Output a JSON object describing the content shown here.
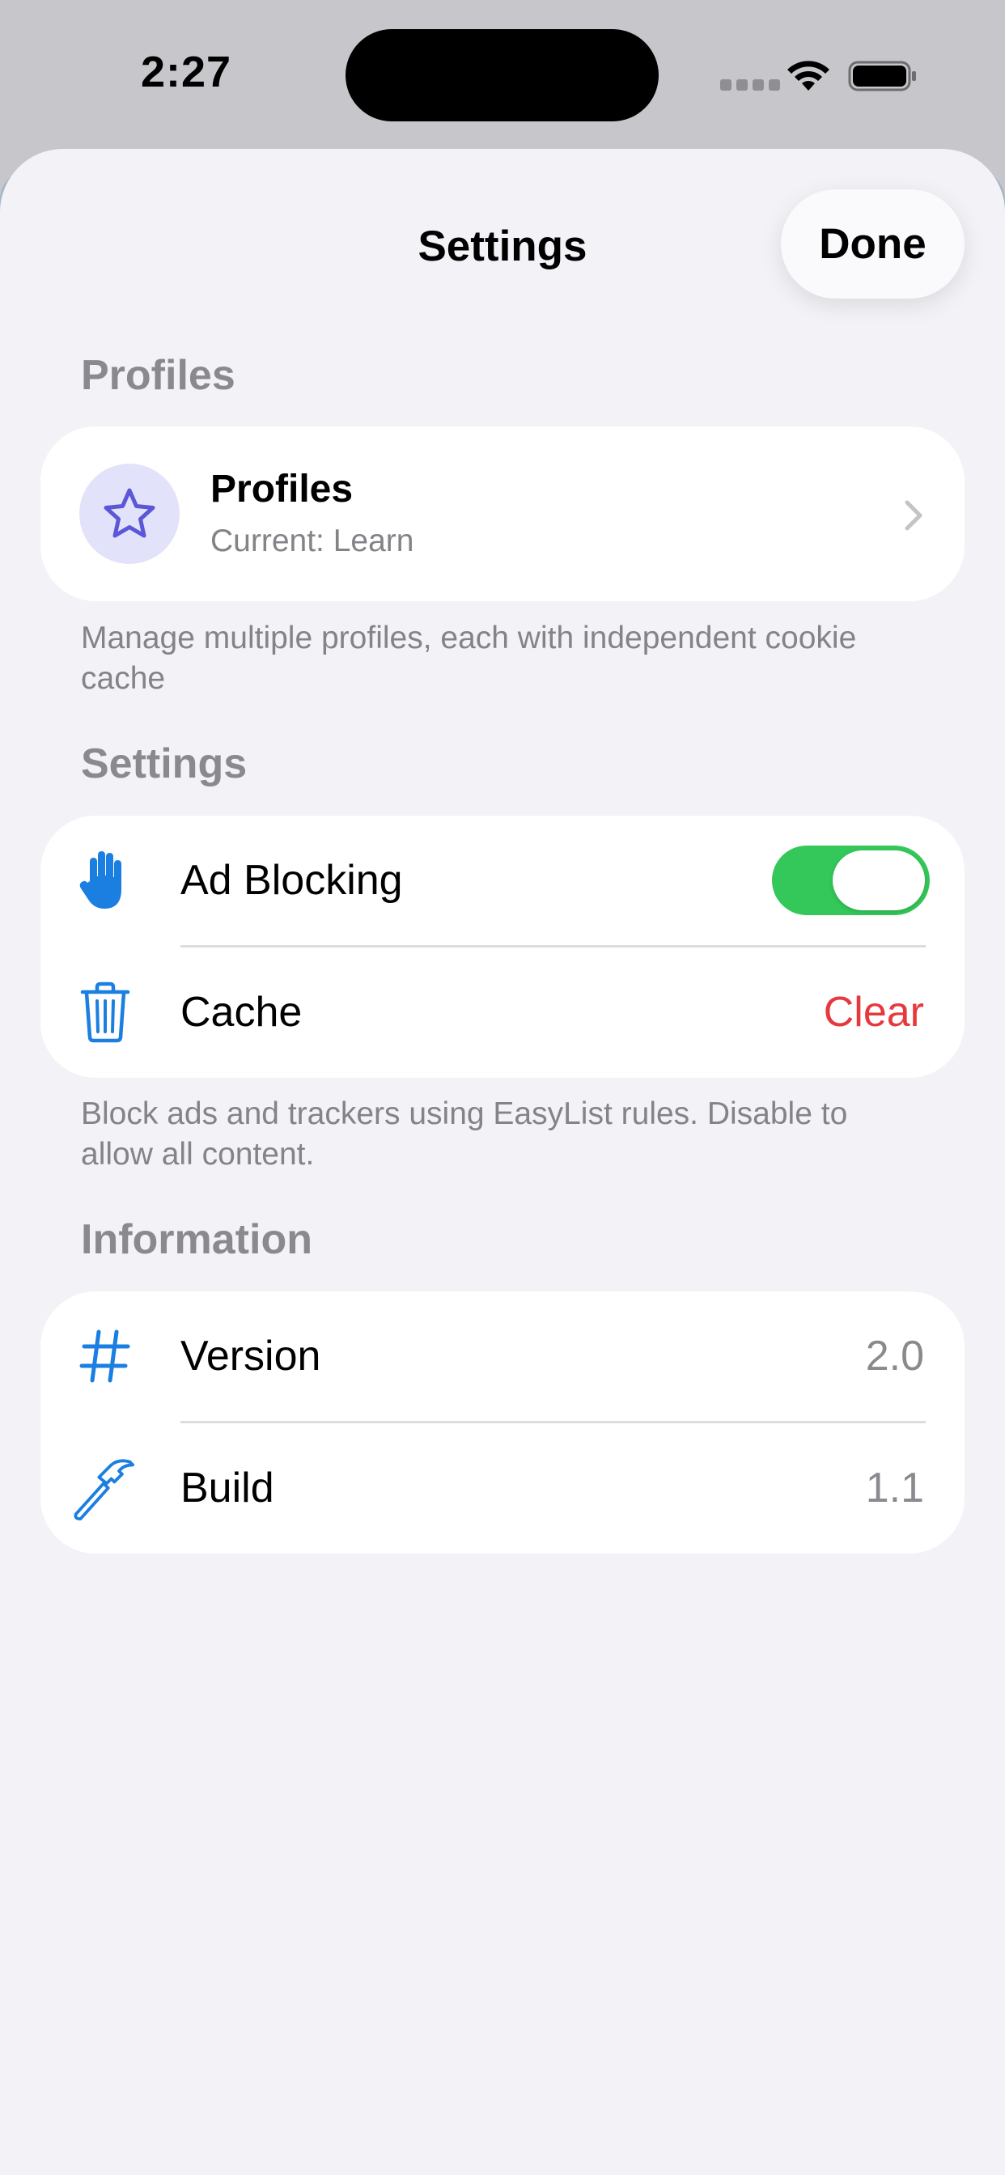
{
  "status_bar": {
    "time": "2:27"
  },
  "sheet": {
    "title": "Settings",
    "done_label": "Done"
  },
  "profiles_section": {
    "header": "Profiles",
    "row_title": "Profiles",
    "row_subtitle": "Current: Learn",
    "footer": "Manage multiple profiles, each with independent cookie cache"
  },
  "settings_section": {
    "header": "Settings",
    "ad_blocking": {
      "label": "Ad Blocking",
      "enabled": true
    },
    "cache": {
      "label": "Cache",
      "action": "Clear"
    },
    "footer": "Block ads and trackers using EasyList rules. Disable to allow all content."
  },
  "information_section": {
    "header": "Information",
    "version": {
      "label": "Version",
      "value": "2.0"
    },
    "build": {
      "label": "Build",
      "value": "1.1"
    }
  },
  "icons": {
    "profiles": "star-icon",
    "ad_blocking": "hand-raised-icon",
    "cache": "trash-icon",
    "version": "number-sign-icon",
    "build": "hammer-icon",
    "disclosure": "chevron-right-icon"
  },
  "colors": {
    "accent_blue": "#1a7fe0",
    "toggle_on": "#34c759",
    "destructive": "#e5393e",
    "profile_purple": "#5b57d6",
    "profile_bg": "#e3e2fb"
  }
}
